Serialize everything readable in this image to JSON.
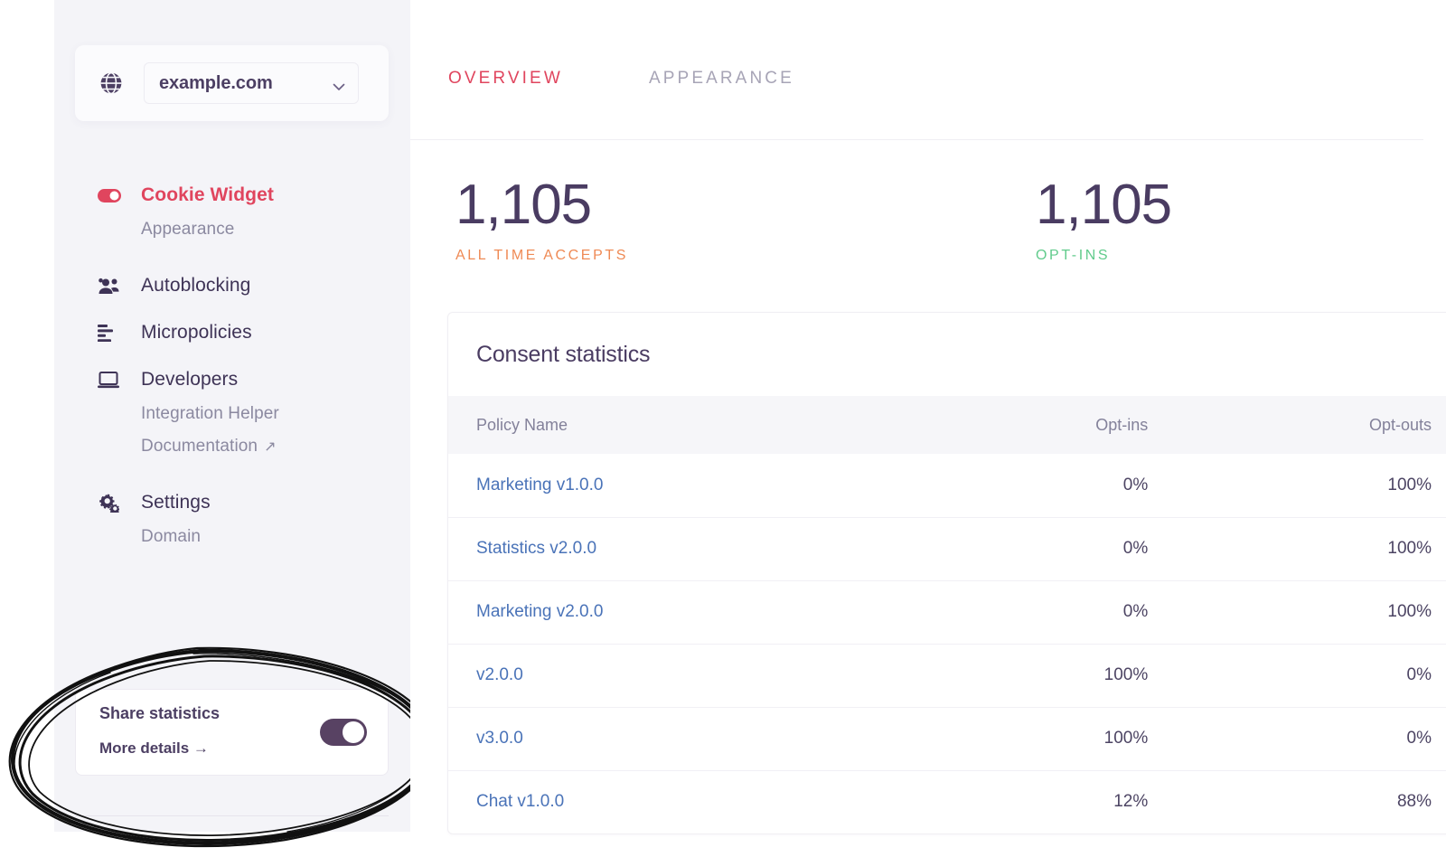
{
  "sidebar": {
    "domain_selector": {
      "globe_icon": "globe-icon",
      "value": "example.com",
      "chevron_icon": "chevron-down-icon"
    },
    "items": [
      {
        "label": "Cookie Widget",
        "icon": "toggle-icon",
        "active": true
      },
      {
        "label": "Appearance",
        "sub": true
      },
      {
        "label": "Autoblocking",
        "icon": "users-icon"
      },
      {
        "label": "Micropolicies",
        "icon": "list-icon"
      },
      {
        "label": "Developers",
        "icon": "laptop-icon"
      },
      {
        "label": "Integration Helper",
        "sub": true
      },
      {
        "label": "Documentation",
        "sub": true,
        "external": "↗"
      },
      {
        "label": "Settings",
        "icon": "gears-icon"
      },
      {
        "label": "Domain",
        "sub": true
      }
    ],
    "share_card": {
      "title": "Share statistics",
      "more_details": "More details →",
      "toggle_on": true,
      "toggle_color": "#584263"
    }
  },
  "main": {
    "tabs": [
      {
        "label": "OVERVIEW",
        "active": true,
        "color": "#e0455e"
      },
      {
        "label": "APPEARANCE",
        "active": false,
        "color": "#a7a4b6"
      }
    ],
    "stats": [
      {
        "value": "1,105",
        "label": "ALL TIME ACCEPTS",
        "color": "#ef8a55"
      },
      {
        "value": "1,105",
        "label": "OPT-INS",
        "color": "#61cb8c"
      }
    ],
    "panel": {
      "title": "Consent statistics",
      "columns": [
        "Policy Name",
        "Opt-ins",
        "Opt-outs"
      ],
      "rows": [
        {
          "name": "Marketing v1.0.0",
          "optins": "0%",
          "optouts": "100%"
        },
        {
          "name": "Statistics v2.0.0",
          "optins": "0%",
          "optouts": "100%"
        },
        {
          "name": "Marketing v2.0.0",
          "optins": "0%",
          "optouts": "100%"
        },
        {
          "name": "v2.0.0",
          "optins": "100%",
          "optouts": "0%"
        },
        {
          "name": "v3.0.0",
          "optins": "100%",
          "optouts": "0%"
        },
        {
          "name": "Chat v1.0.0",
          "optins": "12%",
          "optouts": "88%"
        }
      ]
    }
  },
  "annotation": {
    "type": "hand-drawn-ellipse",
    "target": "share-statistics-card",
    "color": "#111111"
  },
  "theme": {
    "accent_red": "#e0455e",
    "accent_purple": "#4a3c62",
    "link_blue": "#4a73b8",
    "sidebar_bg": "#f4f4f8"
  }
}
